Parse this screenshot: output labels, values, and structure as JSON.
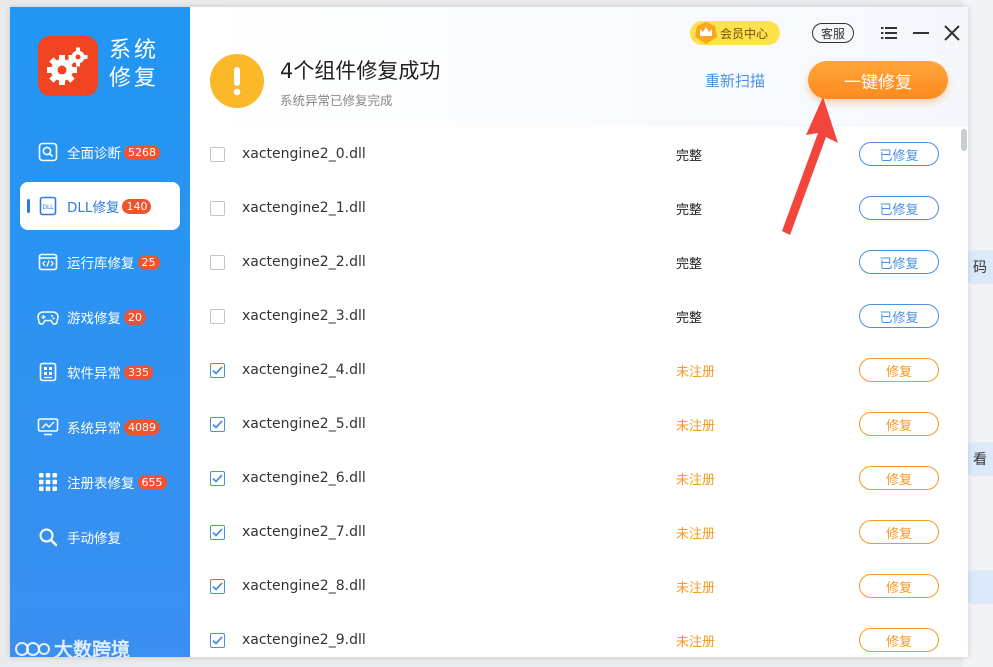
{
  "background": {
    "chips": [
      "码",
      "看",
      ""
    ]
  },
  "sidebar": {
    "logo_text": "系统\n修复",
    "items": [
      {
        "label": "全面诊断",
        "badge": "5268",
        "icon": "search-screen-icon"
      },
      {
        "label": "DLL修复",
        "badge": "140",
        "icon": "dll-file-icon"
      },
      {
        "label": "运行库修复",
        "badge": "25",
        "icon": "code-window-icon"
      },
      {
        "label": "游戏修复",
        "badge": "20",
        "icon": "gamepad-icon"
      },
      {
        "label": "软件异常",
        "badge": "335",
        "icon": "app-grid-icon"
      },
      {
        "label": "系统异常",
        "badge": "4089",
        "icon": "monitor-icon"
      },
      {
        "label": "注册表修复",
        "badge": "655",
        "icon": "grid-dots-icon"
      },
      {
        "label": "手动修复",
        "badge": "",
        "icon": "magnifier-icon"
      }
    ],
    "active_index": 1,
    "watermark": "大数跨境"
  },
  "header": {
    "title": "4个组件修复成功",
    "subtitle": "系统异常已修复完成",
    "vip_label": "会员中心",
    "service_label": "客服",
    "rescan_label": "重新扫描",
    "fixall_label": "一键修复"
  },
  "rows": [
    {
      "name": "xactengine2_0.dll",
      "checked": false,
      "status": "完整",
      "action": "已修复",
      "state": "done"
    },
    {
      "name": "xactengine2_1.dll",
      "checked": false,
      "status": "完整",
      "action": "已修复",
      "state": "done"
    },
    {
      "name": "xactengine2_2.dll",
      "checked": false,
      "status": "完整",
      "action": "已修复",
      "state": "done"
    },
    {
      "name": "xactengine2_3.dll",
      "checked": false,
      "status": "完整",
      "action": "已修复",
      "state": "done"
    },
    {
      "name": "xactengine2_4.dll",
      "checked": true,
      "status": "未注册",
      "action": "修复",
      "state": "fix"
    },
    {
      "name": "xactengine2_5.dll",
      "checked": true,
      "status": "未注册",
      "action": "修复",
      "state": "fix"
    },
    {
      "name": "xactengine2_6.dll",
      "checked": true,
      "status": "未注册",
      "action": "修复",
      "state": "fix"
    },
    {
      "name": "xactengine2_7.dll",
      "checked": true,
      "status": "未注册",
      "action": "修复",
      "state": "fix"
    },
    {
      "name": "xactengine2_8.dll",
      "checked": true,
      "status": "未注册",
      "action": "修复",
      "state": "fix"
    },
    {
      "name": "xactengine2_9.dll",
      "checked": true,
      "status": "未注册",
      "action": "修复",
      "state": "fix"
    }
  ],
  "colors": {
    "sidebar": "#2196f3",
    "accent_blue": "#4a90e2",
    "accent_orange": "#f59a23",
    "badge_red": "#f0532f",
    "warning_yellow": "#fbb829"
  }
}
